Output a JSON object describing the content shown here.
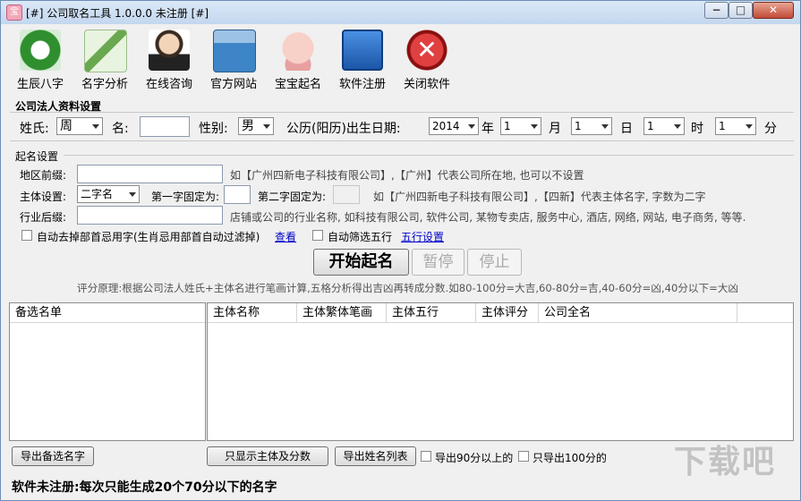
{
  "window": {
    "title": "[#] 公司取名工具 1.0.0.0 未注册 [#]",
    "app_icon": "宝",
    "min": "−",
    "max": "□",
    "close": "✕"
  },
  "toolbar": {
    "items": [
      {
        "label": "生辰八字",
        "icon": "bagua-icon",
        "color": "#3a9a3a"
      },
      {
        "label": "名字分析",
        "icon": "pencil-icon",
        "color": "#6aa84f"
      },
      {
        "label": "在线咨询",
        "icon": "support-agent-icon",
        "color": "#c0a080"
      },
      {
        "label": "官方网站",
        "icon": "building-icon",
        "color": "#3d85c6"
      },
      {
        "label": "宝宝起名",
        "icon": "baby-icon",
        "color": "#e8a0a0"
      },
      {
        "label": "软件注册",
        "icon": "unlock-icon",
        "color": "#2a6fc0"
      },
      {
        "label": "关闭软件",
        "icon": "close-circle-icon",
        "color": "#cc2222"
      }
    ]
  },
  "legal_section": {
    "title": "公司法人资料设置",
    "surname_label": "姓氏:",
    "surname_value": "周",
    "name_label": "名:",
    "name_value": "",
    "gender_label": "性别:",
    "gender_value": "男",
    "birthday_label": "公历(阳历)出生日期:",
    "year_value": "2014",
    "year_unit": "年",
    "month_value": "1",
    "month_unit": "月",
    "day_value": "1",
    "day_unit": "日",
    "hour_value": "1",
    "hour_unit": "时",
    "minute_value": "1",
    "minute_unit": "分"
  },
  "naming_section": {
    "title": "起名设置",
    "region_label": "地区前缀:",
    "region_value": "",
    "region_hint": "如【广州四新电子科技有限公司】,【广州】代表公司所在地, 也可以不设置",
    "subject_label": "主体设置:",
    "subject_value": "二字名",
    "first_char_label": "第一字固定为:",
    "first_char_value": "",
    "second_char_label": "第二字固定为:",
    "second_char_value": "",
    "subject_hint": "如【广州四新电子科技有限公司】,【四新】代表主体名字, 字数为二字",
    "industry_label": "行业后缀:",
    "industry_value": "",
    "industry_hint": "店铺或公司的行业名称, 如科技有限公司, 软件公司, 某物专卖店, 服务中心, 酒店, 网络, 网站, 电子商务, 等等.",
    "auto_remove_label": "自动去掉部首忌用字(生肖忌用部首自动过滤掉)",
    "view_link": "查看",
    "auto_wuxing_label": "自动筛选五行",
    "wuxing_link": "五行设置"
  },
  "actions": {
    "start": "开始起名",
    "pause": "暂停",
    "stop": "停止"
  },
  "scoring_note": "评分原理:根据公司法人姓氏+主体名进行笔画计算,五格分析得出吉凶再转成分数.如80-100分=大吉,60-80分=吉,40-60分=凶,40分以下=大凶",
  "candidates": {
    "header": "备选名单",
    "items": []
  },
  "results": {
    "columns": [
      "主体名称",
      "主体繁体笔画",
      "主体五行",
      "主体评分",
      "公司全名"
    ],
    "rows": []
  },
  "bottom": {
    "export_candidates": "导出备选名字",
    "show_subject_score": "只显示主体及分数",
    "export_name_list": "导出姓名列表",
    "export_90_label": "导出90分以上的",
    "export_100_label": "只导出100分的"
  },
  "status": "软件未注册:每次只能生成20个70分以下的名字",
  "watermark": "下载吧"
}
